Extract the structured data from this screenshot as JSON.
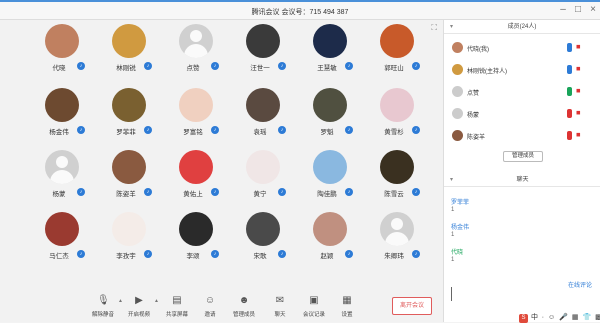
{
  "window": {
    "title": "腾讯会议 会议号：715 494 387",
    "minimize": "–",
    "maximize": "□",
    "close": "×"
  },
  "participants": [
    {
      "name": "代晓",
      "bg": "#c08060"
    },
    {
      "name": "林刚锐",
      "bg": "#d09a40"
    },
    {
      "name": "点赞",
      "bg": ""
    },
    {
      "name": "汪世一",
      "bg": "#3a3a3a"
    },
    {
      "name": "王慧敏",
      "bg": "#1d2b4a"
    },
    {
      "name": "郭旺山",
      "bg": "#c85a2a"
    },
    {
      "name": "杨金伟",
      "bg": "#6d4a30"
    },
    {
      "name": "罗菲菲",
      "bg": "#7a6030"
    },
    {
      "name": "罗富铭",
      "bg": "#f0d0c0"
    },
    {
      "name": "袁瑶",
      "bg": "#5a4a40"
    },
    {
      "name": "罗魁",
      "bg": "#505040"
    },
    {
      "name": "黄雪杉",
      "bg": "#e8c8d0"
    },
    {
      "name": "杨蒙",
      "bg": ""
    },
    {
      "name": "陈姿羊",
      "bg": "#8a5a40"
    },
    {
      "name": "黄佑上",
      "bg": "#e04040"
    },
    {
      "name": "黄宁",
      "bg": "#f0e6e6"
    },
    {
      "name": "陶佳鹏",
      "bg": "#8ab8e0"
    },
    {
      "name": "陈雪云",
      "bg": "#3a3020"
    },
    {
      "name": "马仁杰",
      "bg": "#9a3a30"
    },
    {
      "name": "李孜宇",
      "bg": "#f4ece8"
    },
    {
      "name": "李颂",
      "bg": "#2a2a2a"
    },
    {
      "name": "宋歌",
      "bg": "#4a4a4a"
    },
    {
      "name": "赵颖",
      "bg": "#c09080"
    },
    {
      "name": "朱卿玮",
      "bg": ""
    }
  ],
  "toolbar": {
    "items": [
      {
        "label": "解除静音",
        "icon": "mic-off-icon",
        "glyph": "🎙"
      },
      {
        "label": "开启视频",
        "icon": "camera-off-icon",
        "glyph": "▶"
      },
      {
        "label": "共享屏幕",
        "icon": "screen-share-icon",
        "glyph": "▤"
      },
      {
        "label": "邀请",
        "icon": "invite-icon",
        "glyph": "☺"
      },
      {
        "label": "管理成员",
        "icon": "members-icon",
        "glyph": "☻"
      },
      {
        "label": "聊天",
        "icon": "chat-icon",
        "glyph": "✉"
      },
      {
        "label": "会议记录",
        "icon": "notes-icon",
        "glyph": "▣"
      },
      {
        "label": "设置",
        "icon": "settings-icon",
        "glyph": "▦"
      }
    ],
    "leave_label": "离开会议"
  },
  "members_panel": {
    "header": "成员(24人)",
    "members": [
      {
        "name": "代晓(我)",
        "bg": "#c08060",
        "mic_color": "#2d7bd6",
        "cam": "◼"
      },
      {
        "name": "林刚锐(主持人)",
        "bg": "#d09a40",
        "mic_color": "#2d7bd6",
        "cam": "◼"
      },
      {
        "name": "点赞",
        "bg": "#cccccc",
        "mic_color": "#19a45a",
        "cam": "◼"
      },
      {
        "name": "杨蒙",
        "bg": "#cccccc",
        "mic_color": "#d33",
        "cam": "◼"
      },
      {
        "name": "陈姿羊",
        "bg": "#8a5a40",
        "mic_color": "#d33",
        "cam": "◼"
      }
    ],
    "manage_label": "管理成员"
  },
  "chat_panel": {
    "header": "聊天",
    "messages": [
      {
        "name": "罗菲菲",
        "text": "1",
        "color": "#2d7bd6"
      },
      {
        "name": "杨金伟",
        "text": "1",
        "color": "#2d7bd6"
      },
      {
        "name": "代晓",
        "text": "1",
        "color": "#19a45a"
      }
    ],
    "link": "在线评论",
    "input_placeholder": ""
  },
  "tray": {
    "items": [
      "中",
      "∙",
      "☺",
      "🎤",
      "▦",
      "👕",
      "▩"
    ]
  }
}
